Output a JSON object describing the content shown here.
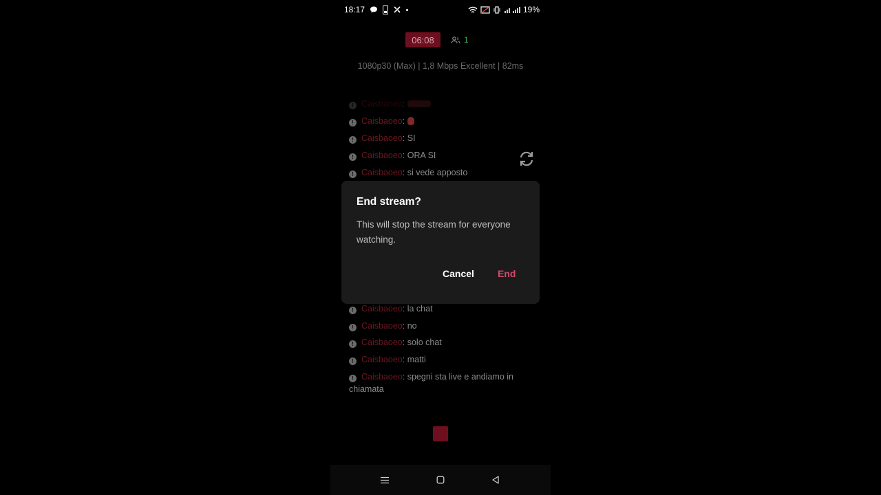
{
  "status_bar": {
    "time": "18:17",
    "battery_percent": "19%",
    "left_icons": [
      "chat-bubble-icon",
      "battery-saver-icon",
      "tools-icon",
      "dot-icon"
    ],
    "right_icons": [
      "wifi-icon",
      "cast-icon",
      "vibrate-icon",
      "signal-icon"
    ]
  },
  "stream": {
    "timer": "06:08",
    "viewer_count": "1",
    "stats": "1080p30 (Max) | 1,8 Mbps Excellent | 82ms"
  },
  "chat": {
    "messages": [
      {
        "user": "Caisbaoeo",
        "sep": ": ",
        "text": "",
        "faded": true
      },
      {
        "user": "Caisbaoeo",
        "sep": ": ",
        "text": "",
        "emoji": true
      },
      {
        "user": "Caisbaoeo",
        "sep": ": ",
        "text": "SI"
      },
      {
        "user": "Caisbaoeo",
        "sep": ": ",
        "text": "ORA SI"
      },
      {
        "user": "Caisbaoeo",
        "sep": ": ",
        "text": "si vede apposto"
      },
      {
        "user": "Caisbaoeo",
        "sep": ": ",
        "text": "la chat"
      },
      {
        "user": "Caisbaoeo",
        "sep": ": ",
        "text": "no"
      },
      {
        "user": "Caisbaoeo",
        "sep": ": ",
        "text": "solo chat"
      },
      {
        "user": "Caisbaoeo",
        "sep": ": ",
        "text": "matti"
      },
      {
        "user": "Caisbaoeo",
        "sep": ": ",
        "text": "spegni sta live e andiamo in chiamata"
      }
    ]
  },
  "dialog": {
    "title": "End stream?",
    "body": "This will stop the stream for everyone watching.",
    "cancel_label": "Cancel",
    "end_label": "End"
  },
  "colors": {
    "accent_red": "#6e0f1f",
    "end_button": "#d04a6c",
    "viewer_green": "#3ea84a",
    "username": "#6e1620"
  },
  "nav": {
    "icons": [
      "menu-icon",
      "home-icon",
      "back-icon"
    ]
  }
}
